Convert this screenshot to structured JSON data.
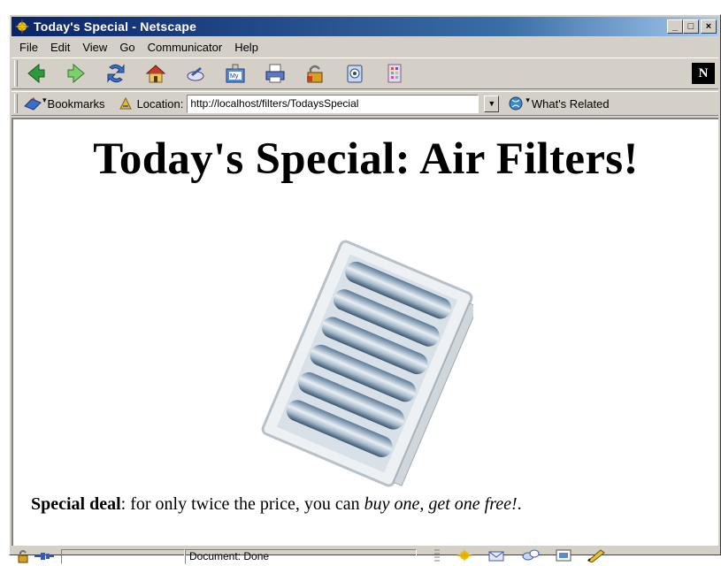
{
  "window": {
    "title": "Today's Special - Netscape",
    "min_label": "_",
    "max_label": "□",
    "close_label": "×"
  },
  "menubar": {
    "items": [
      "File",
      "Edit",
      "View",
      "Go",
      "Communicator",
      "Help"
    ]
  },
  "toolbar": {
    "icons": [
      "back-icon",
      "forward-icon",
      "reload-icon",
      "home-icon",
      "search-icon",
      "netscape-guide-icon",
      "print-icon",
      "security-icon",
      "shop-icon",
      "stop-icon"
    ],
    "brand_letter": "N"
  },
  "locbar": {
    "bookmarks_label": "Bookmarks",
    "location_label": "Location:",
    "url": "http://localhost/filters/TodaysSpecial",
    "whats_related_label": "What's Related"
  },
  "page": {
    "title": "Today's Special: Air Filters!",
    "special_bold": "Special deal",
    "special_text": ": for only twice the price, you can",
    "special_italic": "buy one, get one free!",
    "special_end": "."
  },
  "status": {
    "text": "Document: Done"
  },
  "colors": {
    "chrome": "#d4d0c8",
    "titlebar": "#0a246a",
    "content_bg": "#ffffff"
  }
}
